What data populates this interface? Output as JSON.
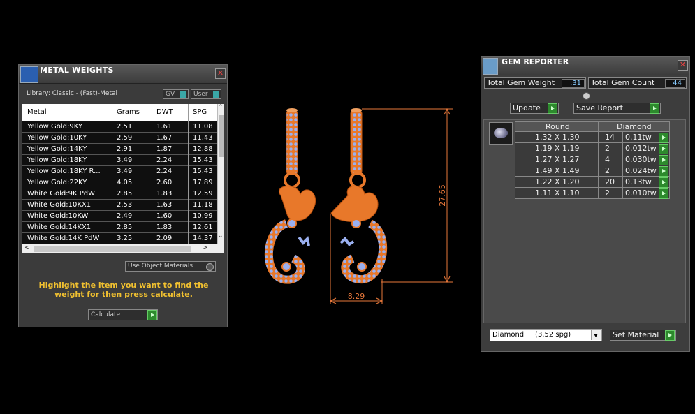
{
  "metal_weights": {
    "title": "METAL WEIGHTS",
    "close_glyph": "✕",
    "library": "Library: Classic - (Fast)-Metal",
    "gv_label": "GV",
    "user_label": "User",
    "columns": [
      "Metal",
      "Grams",
      "DWT",
      "SPG"
    ],
    "rows": [
      [
        "Yellow Gold:9KY",
        "2.51",
        "1.61",
        "11.08"
      ],
      [
        "Yellow Gold:10KY",
        "2.59",
        "1.67",
        "11.43"
      ],
      [
        "Yellow Gold:14KY",
        "2.91",
        "1.87",
        "12.88"
      ],
      [
        "Yellow Gold:18KY",
        "3.49",
        "2.24",
        "15.43"
      ],
      [
        "Yellow Gold:18KY R...",
        "3.49",
        "2.24",
        "15.43"
      ],
      [
        "Yellow Gold:22KY",
        "4.05",
        "2.60",
        "17.89"
      ],
      [
        "White Gold:9K PdW",
        "2.85",
        "1.83",
        "12.59"
      ],
      [
        "White Gold:10KX1",
        "2.53",
        "1.63",
        "11.18"
      ],
      [
        "White Gold:10KW",
        "2.49",
        "1.60",
        "10.99"
      ],
      [
        "White Gold:14KX1",
        "2.85",
        "1.83",
        "12.61"
      ],
      [
        "White Gold:14K PdW",
        "3.25",
        "2.09",
        "14.37"
      ]
    ],
    "scroll_up": "⌃",
    "scroll_down": "⌄",
    "scroll_left": "<",
    "scroll_right": ">",
    "use_object_materials": "Use Object Materials",
    "help_text": "Highlight the item you want to find the weight for then press calculate.",
    "calculate_label": "Calculate"
  },
  "gem_reporter": {
    "title": "GEM REPORTER",
    "close_glyph": "✕",
    "total_gem_weight_label": "Total Gem Weight",
    "total_gem_weight": ".31",
    "total_gem_count_label": "Total Gem Count",
    "total_gem_count": "44",
    "update_label": "Update",
    "save_report_label": "Save Report",
    "table_headers": [
      "Round",
      "Diamond"
    ],
    "gems": [
      {
        "size": "1.32 X 1.30",
        "count": "14",
        "weight": "0.11tw"
      },
      {
        "size": "1.19 X 1.19",
        "count": "2",
        "weight": "0.012tw"
      },
      {
        "size": "1.27 X 1.27",
        "count": "4",
        "weight": "0.030tw"
      },
      {
        "size": "1.49 X 1.49",
        "count": "2",
        "weight": "0.024tw"
      },
      {
        "size": "1.22 X 1.20",
        "count": "20",
        "weight": "0.13tw"
      },
      {
        "size": "1.11 X 1.10",
        "count": "2",
        "weight": "0.010tw"
      }
    ],
    "material_select": "Diamond     (3.52 spg)",
    "set_material_label": "Set Material"
  },
  "viewport": {
    "height_dimension": "27.65",
    "width_dimension": "8.29",
    "colors": {
      "metal": "#e8782a",
      "gems": "#9ab0f0",
      "dimension": "#e8783a"
    }
  }
}
